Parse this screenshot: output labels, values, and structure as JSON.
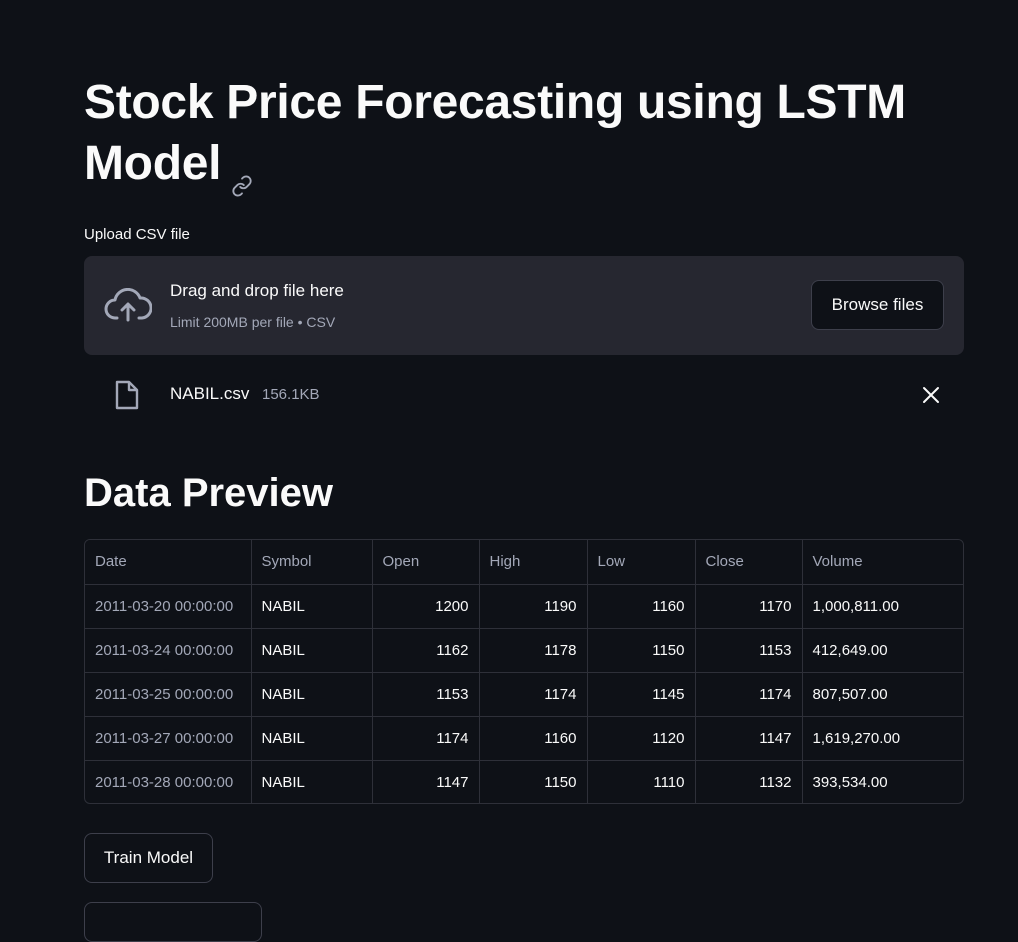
{
  "title": "Stock Price Forecasting using LSTM Model",
  "uploader": {
    "label": "Upload CSV file",
    "drop_text": "Drag and drop file here",
    "limit_text": "Limit 200MB per file • CSV",
    "browse_label": "Browse files",
    "file_name": "NABIL.csv",
    "file_size": "156.1KB"
  },
  "preview": {
    "title": "Data Preview",
    "columns": [
      "Date",
      "Symbol",
      "Open",
      "High",
      "Low",
      "Close",
      "Volume"
    ],
    "rows": [
      [
        "2011-03-20 00:00:00",
        "NABIL",
        "1200",
        "1190",
        "1160",
        "1170",
        "1,000,811.00"
      ],
      [
        "2011-03-24 00:00:00",
        "NABIL",
        "1162",
        "1178",
        "1150",
        "1153",
        "412,649.00"
      ],
      [
        "2011-03-25 00:00:00",
        "NABIL",
        "1153",
        "1174",
        "1145",
        "1174",
        "807,507.00"
      ],
      [
        "2011-03-27 00:00:00",
        "NABIL",
        "1174",
        "1160",
        "1120",
        "1147",
        "1,619,270.00"
      ],
      [
        "2011-03-28 00:00:00",
        "NABIL",
        "1147",
        "1150",
        "1110",
        "1132",
        "393,534.00"
      ]
    ]
  },
  "actions": {
    "train_label": "Train Model"
  },
  "colors": {
    "background": "#0e1117",
    "surface": "#262730",
    "text": "#fafafa",
    "muted": "#a3a8b8",
    "border": "#2e3039"
  },
  "icons": {
    "anchor": "link-icon",
    "upload": "cloud-upload-icon",
    "file": "file-icon",
    "remove": "close-icon"
  }
}
